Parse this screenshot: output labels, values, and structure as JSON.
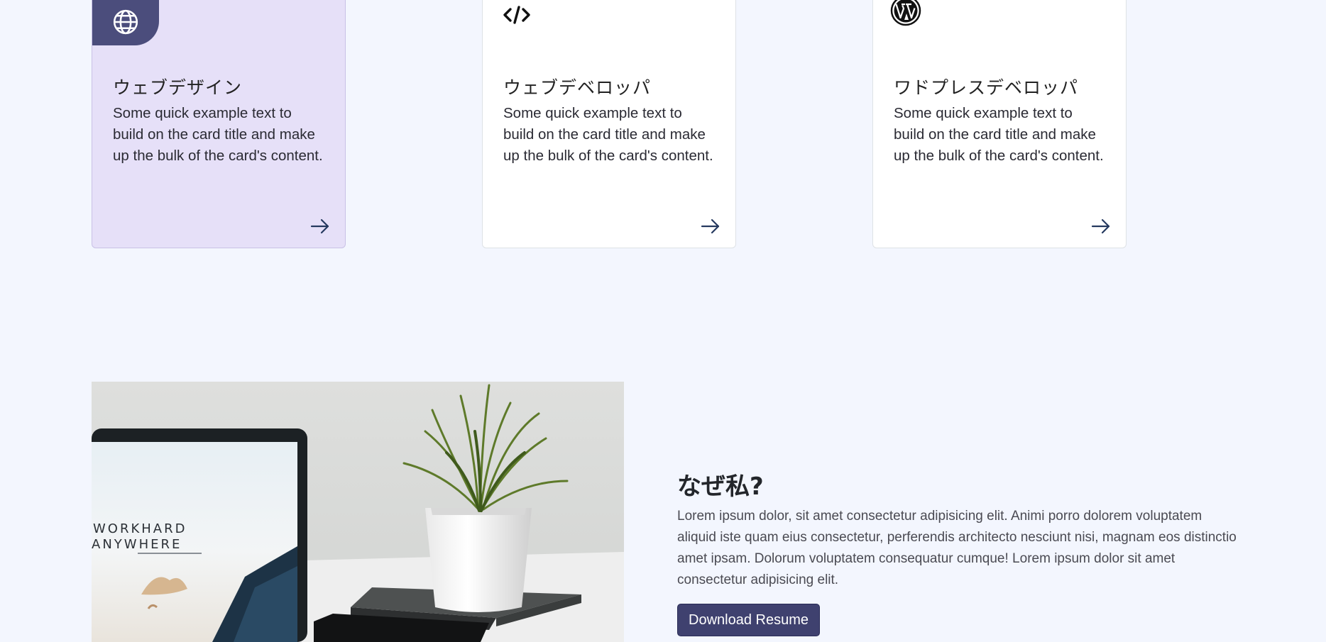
{
  "services": [
    {
      "title": "ウェブデザイン",
      "text": "Some quick example text to build on the card title and make up the bulk of the card's content.",
      "icon": "globe-icon",
      "active": true
    },
    {
      "title": "ウェブデベロッパ",
      "text": "Some quick example text to build on the card title and make up the bulk of the card's content.",
      "icon": "code-icon",
      "active": false
    },
    {
      "title": "ワドプレスデベロッパ",
      "text": "Some quick example text to build on the card title and make up the bulk of the card's content.",
      "icon": "wordpress-icon",
      "active": false
    }
  ],
  "card_arrow_icon": "arrow-right-icon",
  "why": {
    "title": "なぜ私?",
    "text": "Lorem ipsum dolor, sit amet consectetur adipisicing elit. Animi porro dolorem voluptatem aliquid iste quam eius consectetur, perferendis architecto nesciunt nisi, magnam eos distinctio amet ipsam. Dolorum voluptatem consequatur cumque! Lorem ipsum dolor sit amet consectetur adipisicing elit.",
    "button_label": "Download Resume",
    "image_text_line1": "WORKHARD",
    "image_text_line2": "ANYWHERE"
  },
  "colors": {
    "page_background": "#f3f6fe",
    "active_card_background": "#e6e0f8",
    "icon_box": "#4b4d7c",
    "button": "#3f416f",
    "arrow": "#25395f"
  }
}
